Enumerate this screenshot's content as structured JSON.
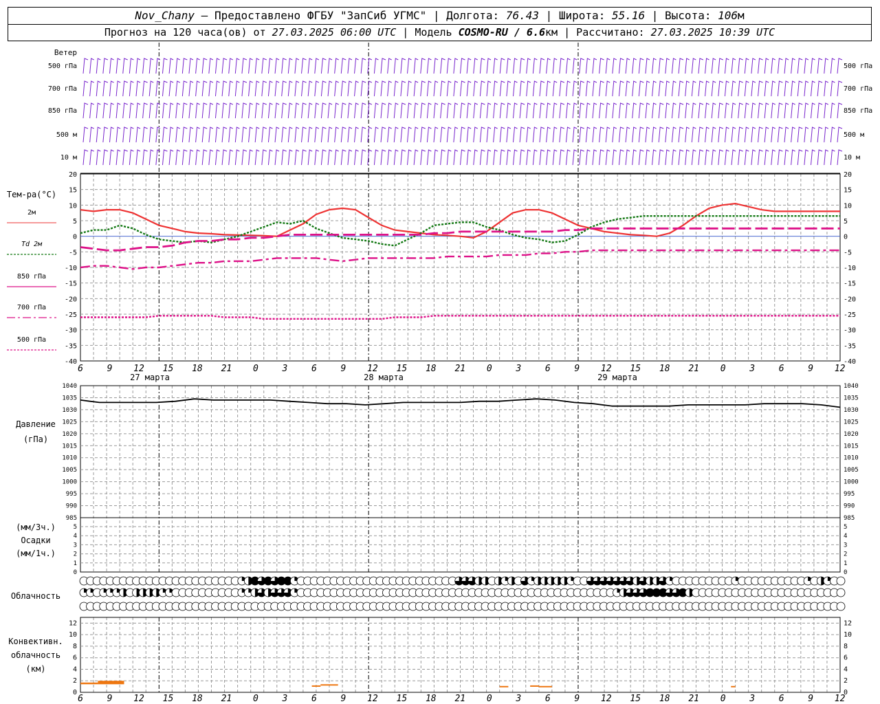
{
  "header": {
    "station": "Nov_Chany",
    "sep1": " — ",
    "provider": "Предоставлено ФГБУ \"ЗапСиб УГМС\"",
    "sep2": " | ",
    "lon_label": "Долгота: ",
    "lon": "76.43",
    "lat_label": "Широта: ",
    "lat": "55.16",
    "alt_label": "Высота: ",
    "alt": "106",
    "alt_unit": "м"
  },
  "subheader": {
    "forecast_label": "Прогноз на 120 часа(ов) от ",
    "forecast_time": "27.03.2025 06:00 UTC",
    "model_label": "  | Модель ",
    "model": "COSMO-RU / 6.6",
    "model_unit": "км",
    "calc_label": " | Рассчитано: ",
    "calc_time": "27.03.2025 10:39 UTC"
  },
  "axis": {
    "hours": [
      "6",
      "9",
      "12",
      "15",
      "18",
      "21",
      "0",
      "3",
      "6",
      "9",
      "12",
      "15",
      "18",
      "21",
      "0",
      "3",
      "6",
      "9",
      "12",
      "15",
      "18",
      "21",
      "0",
      "3",
      "6",
      "9",
      "12"
    ],
    "dates": [
      "27 марта",
      "28 марта",
      "29 марта"
    ]
  },
  "panels": {
    "wind": {
      "title": "Ветер",
      "levels": [
        "500 гПа",
        "700 гПа",
        "850 гПа",
        "500 м",
        "10 м"
      ]
    },
    "temp": {
      "title": "Тем-ра(°C)",
      "ticks": [
        20,
        15,
        10,
        5,
        0,
        -5,
        -10,
        -15,
        -20,
        -25,
        -30,
        -35,
        -40
      ],
      "legend": [
        {
          "label": "2м",
          "color": "#ee3333"
        },
        {
          "label": "Td 2м",
          "color": "#117711"
        },
        {
          "label": "850 гПа",
          "color": "#dd1188"
        },
        {
          "label": "700 гПа",
          "color": "#dd1188"
        },
        {
          "label": "500 гПа",
          "color": "#dd1188"
        }
      ]
    },
    "pressure": {
      "title": "Давление",
      "unit": "(гПа)",
      "ticks": [
        1040,
        1035,
        1030,
        1025,
        1020,
        1015,
        1010,
        1005,
        1000,
        995,
        990,
        985
      ]
    },
    "precip": {
      "title": "Осадки",
      "unit1": "(мм/3ч.)",
      "unit2": "(мм/1ч.)",
      "ticks": [
        5,
        4,
        3,
        2,
        1,
        0
      ]
    },
    "cloud": {
      "title": "Облачность"
    },
    "conv": {
      "title1": "Конвективн.",
      "title2": "облачность",
      "unit": "(км)",
      "ticks": [
        12,
        10,
        8,
        6,
        4,
        2,
        0
      ]
    }
  },
  "chart_data": [
    {
      "type": "line",
      "title": "Тем-ра(°C)",
      "ylim": [
        -40,
        20
      ],
      "x_hours_from_start": [
        0,
        3,
        6,
        9,
        12,
        15,
        18,
        21,
        24,
        27,
        30,
        33,
        36,
        39,
        42,
        45,
        48,
        51,
        54,
        57,
        60,
        63,
        66,
        69,
        72,
        75,
        78,
        81,
        84,
        87,
        90,
        93,
        96,
        99,
        102,
        105,
        108,
        111,
        114,
        117,
        120,
        123,
        126,
        129,
        132,
        135,
        138,
        141,
        144,
        147,
        150,
        153,
        156,
        159,
        162,
        165,
        168,
        171,
        174
      ],
      "series": [
        {
          "name": "2м",
          "values": [
            8.5,
            8.0,
            8.5,
            8.5,
            7.5,
            5.5,
            3.5,
            2.5,
            1.5,
            1.0,
            0.8,
            0.5,
            0.4,
            0.3,
            0.2,
            0.0,
            2.0,
            4.0,
            7.0,
            8.5,
            9.0,
            8.5,
            6.0,
            3.5,
            2.0,
            1.5,
            1.0,
            0.5,
            0.3,
            0.0,
            -0.5,
            1.5,
            4.5,
            7.5,
            8.5,
            8.5,
            7.5,
            5.5,
            3.5,
            2.5,
            1.5,
            1.0,
            0.5,
            0.3,
            0.0,
            1.0,
            3.5,
            6.5,
            9.0,
            10.0,
            10.5,
            9.5,
            8.5,
            8.0,
            8.0,
            8.0,
            8.0,
            8.0,
            8.0
          ]
        },
        {
          "name": "Td 2м",
          "values": [
            1.0,
            2.0,
            2.0,
            3.5,
            2.5,
            0.5,
            -1.0,
            -1.5,
            -2.0,
            -1.5,
            -2.0,
            -1.0,
            0.0,
            1.5,
            3.0,
            4.5,
            4.0,
            5.0,
            2.5,
            1.0,
            -0.5,
            -1.0,
            -1.5,
            -2.5,
            -3.0,
            -1.0,
            1.0,
            3.5,
            4.0,
            4.5,
            4.5,
            3.0,
            2.0,
            0.5,
            -0.5,
            -1.0,
            -2.0,
            -1.5,
            0.5,
            3.0,
            4.5,
            5.5,
            6.0,
            6.5,
            6.5,
            6.5,
            6.5,
            6.5,
            6.5,
            6.5,
            6.5,
            6.5,
            6.5,
            6.5,
            6.5,
            6.5,
            6.5,
            6.5,
            6.5
          ]
        },
        {
          "name": "850 гПа",
          "values": [
            -3.5,
            -4.0,
            -4.5,
            -4.5,
            -4.0,
            -3.5,
            -3.5,
            -3.0,
            -2.0,
            -1.5,
            -1.5,
            -1.0,
            -1.0,
            -0.5,
            -0.5,
            0.0,
            0.5,
            0.5,
            0.5,
            0.5,
            0.5,
            0.5,
            0.5,
            0.5,
            0.5,
            0.5,
            0.5,
            1.0,
            1.0,
            1.5,
            1.5,
            1.5,
            1.5,
            1.5,
            1.5,
            1.5,
            1.5,
            2.0,
            2.0,
            2.5,
            2.5,
            2.5,
            2.5,
            2.5,
            2.5,
            2.5,
            2.5,
            2.5,
            2.5,
            2.5,
            2.5,
            2.5,
            2.5,
            2.5,
            2.5,
            2.5,
            2.5,
            2.5,
            2.5
          ]
        },
        {
          "name": "700 гПа",
          "values": [
            -10,
            -9.5,
            -9.5,
            -10,
            -10.5,
            -10,
            -10,
            -9.5,
            -9,
            -8.5,
            -8.5,
            -8,
            -8,
            -8,
            -7.5,
            -7,
            -7,
            -7,
            -7,
            -7.5,
            -8,
            -7.5,
            -7,
            -7,
            -7,
            -7,
            -7,
            -7,
            -6.5,
            -6.5,
            -6.5,
            -6.5,
            -6,
            -6,
            -6,
            -5.5,
            -5.5,
            -5,
            -5,
            -4.5,
            -4.5,
            -4.5,
            -4.5,
            -4.5,
            -4.5,
            -4.5,
            -4.5,
            -4.5,
            -4.5,
            -4.5,
            -4.5,
            -4.5,
            -4.5,
            -4.5,
            -4.5,
            -4.5,
            -4.5,
            -4.5,
            -4.5
          ]
        },
        {
          "name": "500 гПа",
          "values": [
            -26,
            -26,
            -26,
            -26,
            -26,
            -26,
            -25.5,
            -25.5,
            -25.5,
            -25.5,
            -25.5,
            -26,
            -26,
            -26,
            -26.5,
            -26.5,
            -26.5,
            -26.5,
            -26.5,
            -26.5,
            -26.5,
            -26.5,
            -26.5,
            -26.5,
            -26,
            -26,
            -26,
            -25.5,
            -25.5,
            -25.5,
            -25.5,
            -25.5,
            -25.5,
            -25.5,
            -25.5,
            -25.5,
            -25.5,
            -25.5,
            -25.5,
            -25.5,
            -25.5,
            -25.5,
            -25.5,
            -25.5,
            -25.5,
            -25.5,
            -25.5,
            -25.5,
            -25.5,
            -25.5,
            -25.5,
            -25.5,
            -25.5,
            -25.5,
            -25.5,
            -25.5,
            -25.5,
            -25.5,
            -25.5
          ]
        }
      ]
    },
    {
      "type": "line",
      "title": "Давление",
      "ylim": [
        985,
        1040
      ],
      "x_hours_from_start": [
        0,
        3,
        6,
        9,
        12,
        15,
        18,
        21,
        24,
        27,
        30,
        33,
        36,
        39,
        42,
        45,
        48,
        51,
        54,
        57,
        60,
        63,
        66,
        69,
        72,
        75,
        78,
        81,
        84,
        87,
        90,
        93,
        96,
        99,
        102,
        105,
        108,
        111,
        114,
        117,
        120
      ],
      "series": [
        {
          "name": "",
          "values": [
            1034,
            1033,
            1033,
            1033,
            1033,
            1033.5,
            1034.5,
            1034,
            1034,
            1034,
            1034,
            1033.5,
            1033,
            1032.5,
            1032.5,
            1032,
            1032.5,
            1033,
            1033,
            1033,
            1033,
            1033.5,
            1033.5,
            1034,
            1034.5,
            1034,
            1033,
            1032.5,
            1031.5,
            1031.5,
            1031.5,
            1031.5,
            1032,
            1032,
            1032,
            1032,
            1032.5,
            1032.5,
            1032.5,
            1032,
            1031
          ]
        }
      ]
    },
    {
      "type": "bar",
      "title": "Конвективн. облачность",
      "ylim": [
        0,
        13
      ],
      "segments": [
        {
          "from_h": 0,
          "to_h": 4,
          "base": 1.4,
          "top": 1.7
        },
        {
          "from_h": 4,
          "to_h": 10,
          "base": 1.4,
          "top": 2.0
        },
        {
          "from_h": 53,
          "to_h": 55,
          "base": 1.0,
          "top": 1.2
        },
        {
          "from_h": 55,
          "to_h": 59,
          "base": 1.2,
          "top": 1.4
        },
        {
          "from_h": 96,
          "to_h": 98,
          "base": 0.9,
          "top": 1.1
        },
        {
          "from_h": 103,
          "to_h": 105,
          "base": 1.0,
          "top": 1.2
        },
        {
          "from_h": 105,
          "to_h": 108,
          "base": 0.9,
          "top": 1.1
        },
        {
          "from_h": 149,
          "to_h": 150,
          "base": 0.9,
          "top": 1.1
        }
      ]
    }
  ],
  "clouds": {
    "upper": [
      0,
      0,
      0,
      0,
      0,
      0,
      0,
      0,
      0,
      0,
      0,
      0,
      0,
      0,
      0,
      0,
      0,
      0,
      0,
      0,
      0,
      0,
      0,
      0,
      1,
      2,
      4,
      3,
      4,
      3,
      4,
      4,
      1,
      0,
      0,
      0,
      0,
      0,
      0,
      0,
      0,
      0,
      0,
      0,
      0,
      0,
      0,
      0,
      0,
      0,
      0,
      0,
      0,
      0,
      0,
      0,
      0,
      3,
      3,
      3,
      2,
      2,
      0,
      2,
      1,
      2,
      0,
      3,
      1,
      2,
      2,
      2,
      2,
      2,
      1,
      0,
      0,
      3,
      3,
      3,
      3,
      3,
      3,
      3,
      2,
      3,
      2,
      2,
      3,
      1,
      0,
      0,
      0,
      0,
      0,
      0,
      0,
      0,
      0,
      1,
      0,
      0,
      0,
      0,
      0,
      0,
      0,
      0,
      0,
      0,
      1,
      0,
      2,
      1,
      0,
      0
    ],
    "middle": [
      1,
      1,
      0,
      1,
      1,
      1,
      2,
      0,
      2,
      2,
      2,
      2,
      1,
      1,
      0,
      0,
      0,
      0,
      0,
      0,
      0,
      0,
      0,
      0,
      1,
      1,
      2,
      3,
      2,
      3,
      3,
      3,
      1,
      0,
      0,
      0,
      0,
      0,
      0,
      0,
      0,
      0,
      0,
      0,
      0,
      0,
      0,
      0,
      0,
      0,
      0,
      0,
      0,
      0,
      0,
      0,
      0,
      0,
      0,
      0,
      0,
      0,
      0,
      0,
      0,
      0,
      0,
      0,
      0,
      0,
      0,
      0,
      0,
      0,
      0,
      0,
      0,
      0,
      0,
      0,
      0,
      1,
      2,
      3,
      3,
      3,
      4,
      4,
      4,
      3,
      3,
      4,
      2,
      0,
      0,
      0,
      0,
      0,
      0,
      0,
      0,
      0,
      0,
      0,
      0,
      0,
      0,
      0,
      0,
      0,
      0,
      0,
      0,
      0,
      0,
      0
    ],
    "lower": [
      0,
      0,
      0,
      0,
      0,
      0,
      0,
      0,
      0,
      0,
      0,
      0,
      0,
      0,
      0,
      0,
      0,
      0,
      0,
      0,
      0,
      0,
      0,
      0,
      0,
      0,
      0,
      0,
      0,
      0,
      0,
      0,
      0,
      0,
      0,
      0,
      0,
      0,
      0,
      0,
      0,
      0,
      0,
      0,
      0,
      0,
      0,
      0,
      0,
      0,
      0,
      0,
      0,
      0,
      0,
      0,
      0,
      0,
      0,
      0,
      0,
      0,
      0,
      0,
      0,
      0,
      0,
      0,
      0,
      0,
      0,
      0,
      0,
      0,
      0,
      0,
      0,
      0,
      0,
      0,
      0,
      0,
      0,
      0,
      0,
      0,
      0,
      0,
      0,
      0,
      0,
      0,
      0,
      0,
      0,
      0,
      0,
      0,
      0,
      0,
      0,
      0,
      0,
      0,
      0,
      0,
      0,
      0,
      0,
      0,
      0,
      0,
      0,
      0,
      0,
      0
    ]
  },
  "colors": {
    "temp2m": "#ee3333",
    "td": "#117711",
    "upper": "#dd1188",
    "pressure": "#000000",
    "conv": "#ee7711",
    "wind": "#7722cc",
    "grid": "#999999"
  }
}
